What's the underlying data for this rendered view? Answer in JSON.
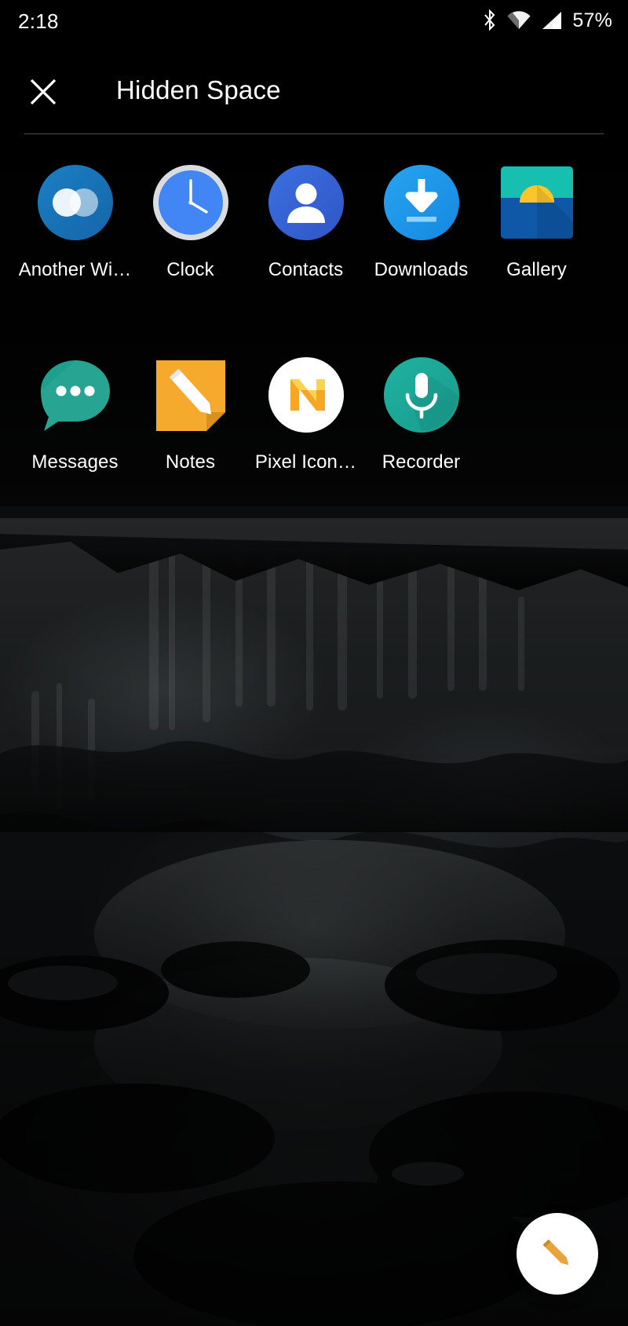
{
  "status_bar": {
    "time": "2:18",
    "battery": "57%",
    "icons": [
      "bluetooth-icon",
      "wifi-icon",
      "cell-signal-icon"
    ]
  },
  "header": {
    "close_icon": "close-icon",
    "title": "Hidden Space"
  },
  "apps": [
    [
      {
        "label": "Another Wi…",
        "icon": "another-widget-icon"
      },
      {
        "label": "Clock",
        "icon": "clock-icon"
      },
      {
        "label": "Contacts",
        "icon": "contacts-icon"
      },
      {
        "label": "Downloads",
        "icon": "downloads-icon"
      },
      {
        "label": "Gallery",
        "icon": "gallery-icon"
      }
    ],
    [
      {
        "label": "Messages",
        "icon": "messages-icon"
      },
      {
        "label": "Notes",
        "icon": "notes-icon"
      },
      {
        "label": "Pixel Icon…",
        "icon": "pixel-icon-pack-icon"
      },
      {
        "label": "Recorder",
        "icon": "recorder-icon"
      }
    ]
  ],
  "fab": {
    "icon": "pencil-edit-icon"
  },
  "colors": {
    "background": "#000000",
    "text": "#ffffff",
    "divider": "rgba(255,255,255,0.30)",
    "fab_background": "#ffffff",
    "fab_icon": "#e8a33d"
  }
}
